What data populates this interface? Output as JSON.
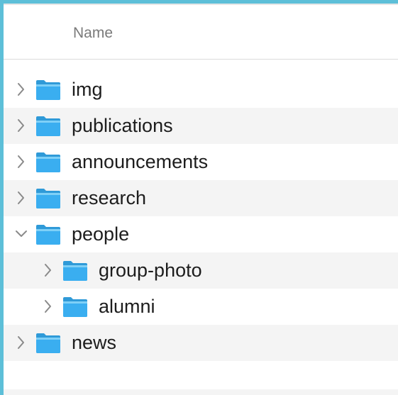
{
  "header": {
    "column_label": "Name"
  },
  "colors": {
    "accent_border": "#5dbfd8",
    "folder": "#3aaef0"
  },
  "rows": [
    {
      "name": "img",
      "level": 0,
      "expanded": false,
      "chevron_icon": "chevron-right-icon"
    },
    {
      "name": "publications",
      "level": 0,
      "expanded": false,
      "chevron_icon": "chevron-right-icon"
    },
    {
      "name": "announcements",
      "level": 0,
      "expanded": false,
      "chevron_icon": "chevron-right-icon"
    },
    {
      "name": "research",
      "level": 0,
      "expanded": false,
      "chevron_icon": "chevron-right-icon"
    },
    {
      "name": "people",
      "level": 0,
      "expanded": true,
      "chevron_icon": "chevron-down-icon"
    },
    {
      "name": "group-photo",
      "level": 1,
      "expanded": false,
      "chevron_icon": "chevron-right-icon"
    },
    {
      "name": "alumni",
      "level": 1,
      "expanded": false,
      "chevron_icon": "chevron-right-icon"
    },
    {
      "name": "news",
      "level": 0,
      "expanded": false,
      "chevron_icon": "chevron-right-icon"
    }
  ]
}
